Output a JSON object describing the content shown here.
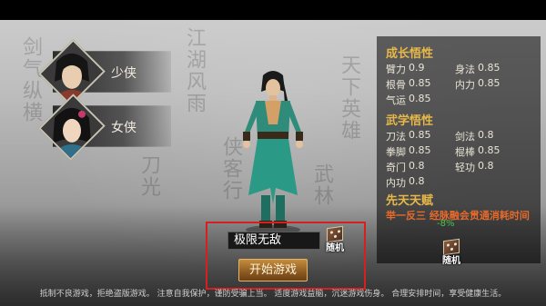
{
  "gender": {
    "male_label": "少侠",
    "female_label": "女侠"
  },
  "growth": {
    "title": "成长悟性",
    "stats": [
      {
        "label": "臂力",
        "value": "0.9"
      },
      {
        "label": "身法",
        "value": "0.85"
      },
      {
        "label": "根骨",
        "value": "0.85"
      },
      {
        "label": "内力",
        "value": "0.85"
      },
      {
        "label": "气运",
        "value": "0.85"
      }
    ]
  },
  "martial": {
    "title": "武学悟性",
    "stats": [
      {
        "label": "刀法",
        "value": "0.85"
      },
      {
        "label": "剑法",
        "value": "0.8"
      },
      {
        "label": "拳脚",
        "value": "0.85"
      },
      {
        "label": "棍棒",
        "value": "0.85"
      },
      {
        "label": "奇门",
        "value": "0.8"
      },
      {
        "label": "轻功",
        "value": "0.8"
      },
      {
        "label": "内功",
        "value": "0.8"
      }
    ]
  },
  "innate": {
    "title": "先天天赋",
    "talent_name": "举一反三",
    "talent_desc": "经脉融会贯通消耗时间",
    "talent_value": "-8%"
  },
  "dice": {
    "label": "随机"
  },
  "name_input": {
    "value": "极限无敌"
  },
  "start_button": {
    "label": "开始游戏"
  },
  "footer": {
    "notice": "抵制不良游戏，拒绝盗版游戏。 注意自我保护，谨防受骗上当。 适度游戏益脑，沉迷游戏伤身。 合理安排时间，享受健康生活。"
  }
}
